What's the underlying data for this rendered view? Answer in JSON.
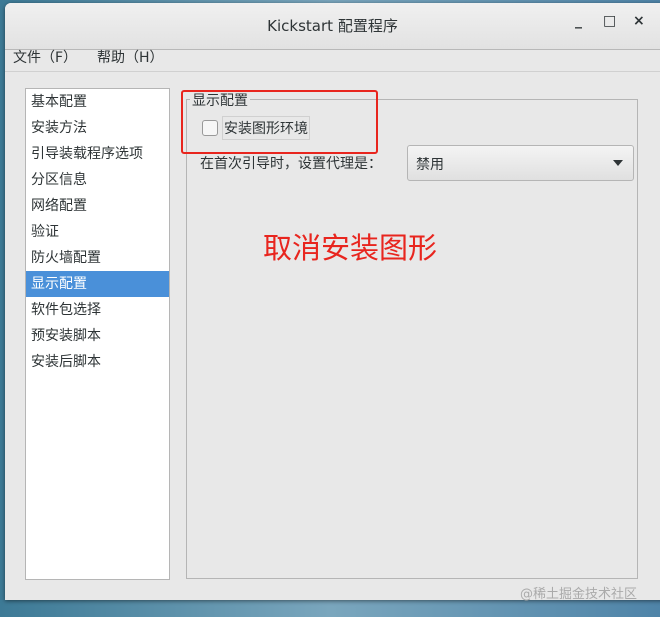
{
  "window": {
    "title": "Kickstart 配置程序",
    "minimize": "_",
    "maximize": "□",
    "close": "×"
  },
  "menu": [
    "文件（F）",
    "帮助（H）"
  ],
  "sidebar": {
    "items": [
      "基本配置",
      "安装方法",
      "引导装载程序选项",
      "分区信息",
      "网络配置",
      "验证",
      "防火墙配置",
      "显示配置",
      "软件包选择",
      "预安装脚本",
      "安装后脚本"
    ],
    "selected": "显示配置"
  },
  "panel": {
    "title": "显示配置",
    "checkbox_label": "安装图形环境",
    "checkbox_checked": false,
    "agent_label": "在首次引导时，设置代理是：",
    "agent_value": "禁用"
  },
  "annotation": "取消安装图形",
  "watermark": "@稀土掘金技术社区"
}
